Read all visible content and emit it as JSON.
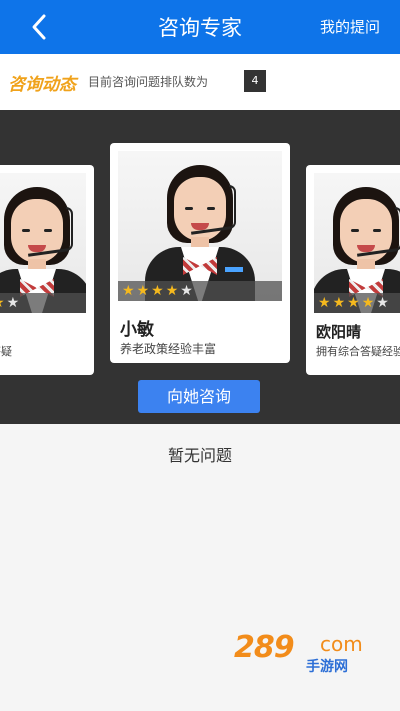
{
  "header": {
    "title": "咨询专家",
    "my_questions": "我的提问"
  },
  "dynamics": {
    "title": "咨询动态",
    "queue_label": "目前咨询问题排队数为",
    "queue_count": "4"
  },
  "experts": [
    {
      "name": "",
      "description": "答疑",
      "stars": [
        true,
        false
      ],
      "position": "left"
    },
    {
      "name": "小敏",
      "description": "养老政策经验丰富",
      "stars": [
        true,
        true,
        true,
        true,
        false
      ],
      "position": "center"
    },
    {
      "name": "欧阳晴",
      "description": "拥有综合答疑经验",
      "stars": [
        true,
        true,
        true,
        true,
        false
      ],
      "position": "right"
    }
  ],
  "consult_button": "向她咨询",
  "empty_text": "暂无问题",
  "watermark": {
    "number": "289",
    "domain": "com",
    "text": "手游网"
  },
  "colors": {
    "header": "#0e74e9",
    "accent": "#f0a21b",
    "button": "#3c82f0",
    "star_on": "#f5b91e"
  }
}
